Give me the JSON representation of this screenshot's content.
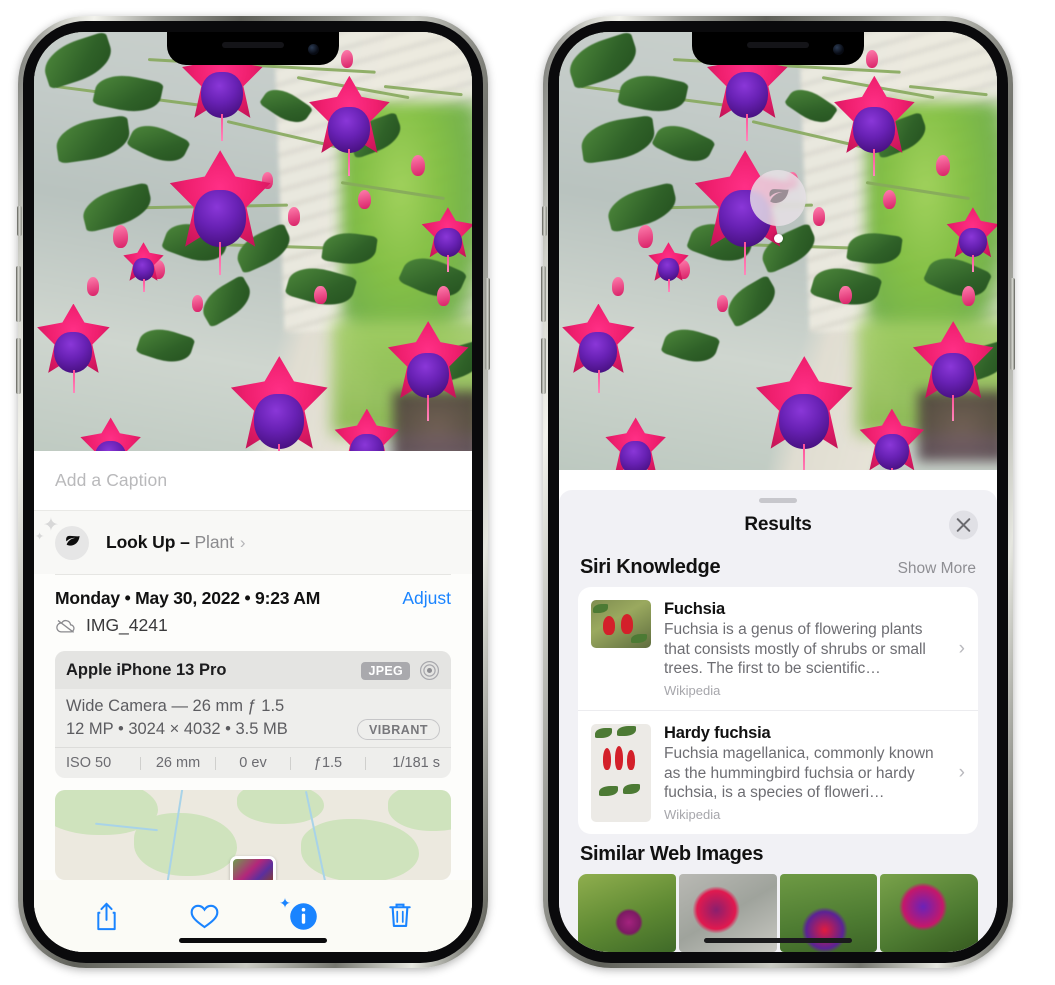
{
  "left_phone": {
    "caption_field": {
      "placeholder": "Add a Caption",
      "value": ""
    },
    "look_up": {
      "label": "Look Up",
      "dash": "–",
      "subject": "Plant",
      "chevron": "›",
      "icon": "leaf-icon"
    },
    "photo_info": {
      "date": "Monday • May 30, 2022 • 9:23 AM",
      "adjust_label": "Adjust",
      "filename": "IMG_4241",
      "cloud_icon": "cloud-slash-icon"
    },
    "exif_card": {
      "device": "Apple iPhone 13 Pro",
      "format_badge": "JPEG",
      "lens_icon": "aperture-icon",
      "lens": "Wide Camera — 26 mm ƒ 1.5",
      "specs": "12 MP • 3024 × 4032 • 3.5 MB",
      "style_badge": "VIBRANT",
      "values": [
        "ISO 50",
        "26 mm",
        "0 ev",
        "ƒ1.5",
        "1/181 s"
      ]
    },
    "toolbar": {
      "share_label": "share-icon",
      "favorite_label": "heart-icon",
      "info_label": "info-icon",
      "delete_label": "trash-icon"
    }
  },
  "right_phone": {
    "visual_lookup_badge": {
      "icon": "leaf-icon"
    },
    "results_sheet": {
      "title": "Results",
      "close_label": "✕",
      "sections": [
        {
          "title": "Siri Knowledge",
          "action": "Show More",
          "items": [
            {
              "title": "Fuchsia",
              "description": "Fuchsia is a genus of flowering plants that consists mostly of shrubs or small trees. The first to be scientific…",
              "source": "Wikipedia",
              "chevron": "›"
            },
            {
              "title": "Hardy fuchsia",
              "description": "Fuchsia magellanica, commonly known as the hummingbird fuchsia or hardy fuchsia, is a species of floweri…",
              "source": "Wikipedia",
              "chevron": "›"
            }
          ]
        },
        {
          "title": "Similar Web Images",
          "images": [
            "fuchsia-web-image-1",
            "fuchsia-web-image-2",
            "fuchsia-web-image-3",
            "fuchsia-web-image-4"
          ]
        }
      ]
    }
  },
  "colors": {
    "accent_blue": "#1a84ff",
    "sheet_bg": "#f1f1f5",
    "card_bg": "#ffffff",
    "secondary_text": "#8e8e93"
  }
}
